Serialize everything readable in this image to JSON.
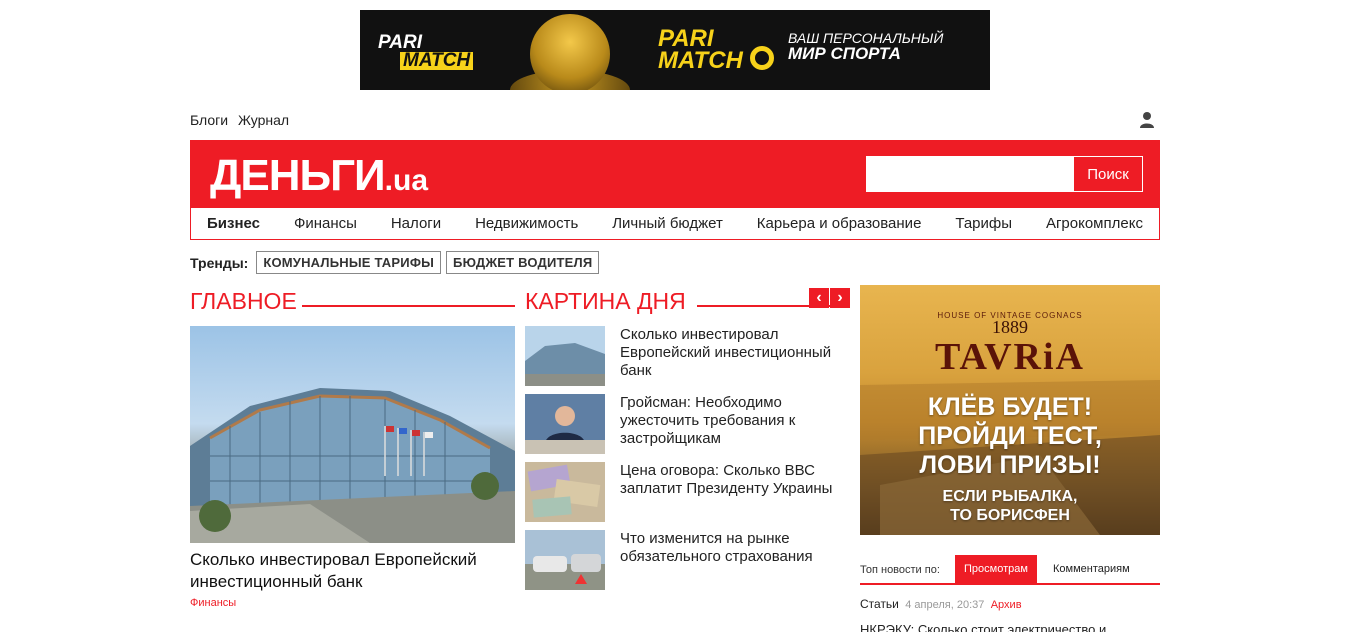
{
  "banner": {
    "logo_line1": "PARI",
    "logo_line2": "MATCH",
    "logo2_line1": "PARI",
    "logo2_line2": "MATCH",
    "slogan_top": "ВАШ ПЕРСОНАЛЬНЫЙ",
    "slogan_bottom": "МИР СПОРТА"
  },
  "top_links": [
    "Блоги",
    "Журнал"
  ],
  "header": {
    "logo_main": "ДЕНЬГИ",
    "logo_suffix": ".ua",
    "search_button": "Поиск",
    "search_value": ""
  },
  "nav": [
    "Бизнес",
    "Финансы",
    "Налоги",
    "Недвижимость",
    "Личный бюджет",
    "Карьера и образование",
    "Тарифы",
    "Агрокомплекс"
  ],
  "trends": {
    "label": "Тренды:",
    "tags": [
      "КОМУНАЛЬНЫЕ ТАРИФЫ",
      "БЮДЖЕТ ВОДИТЕЛЯ"
    ]
  },
  "main_section": {
    "heading": "ГЛАВНОЕ",
    "title": "Сколько инвестировал Европейский инвестиционный банк",
    "category": "Финансы"
  },
  "day_section": {
    "heading": "КАРТИНА ДНЯ",
    "prev": "‹",
    "next": "›",
    "items": [
      "Сколько инвестировал Европейский инвестиционный банк",
      "Гройсман: Необходимо ужесточить требования к застройщикам",
      "Цена оговора: Сколько ВВС заплатит Президенту Украины",
      "Что изменится на рынке обязательного страхования"
    ]
  },
  "ad": {
    "small": "HOUSE OF VINTAGE COGNACS",
    "year": "1889",
    "brand": "TAVRiA",
    "line1": "КЛЁВ БУДЕТ!",
    "line2": "ПРОЙДИ ТЕСТ,",
    "line3": "ЛОВИ ПРИЗЫ!",
    "sub1": "ЕСЛИ РЫБАЛКА,",
    "sub2": "ТО БОРИСФЕН"
  },
  "top_news": {
    "label": "Топ новости по:",
    "tabs": [
      "Просмотрам",
      "Комментариям"
    ],
    "row1_title": "Статьи",
    "row1_time": "4 апреля, 20:37",
    "row1_tag": "Архив",
    "row2_title": "НКРЭКУ: Сколько стоит электричество и"
  },
  "colors": {
    "brand_red": "#ee1c25"
  }
}
